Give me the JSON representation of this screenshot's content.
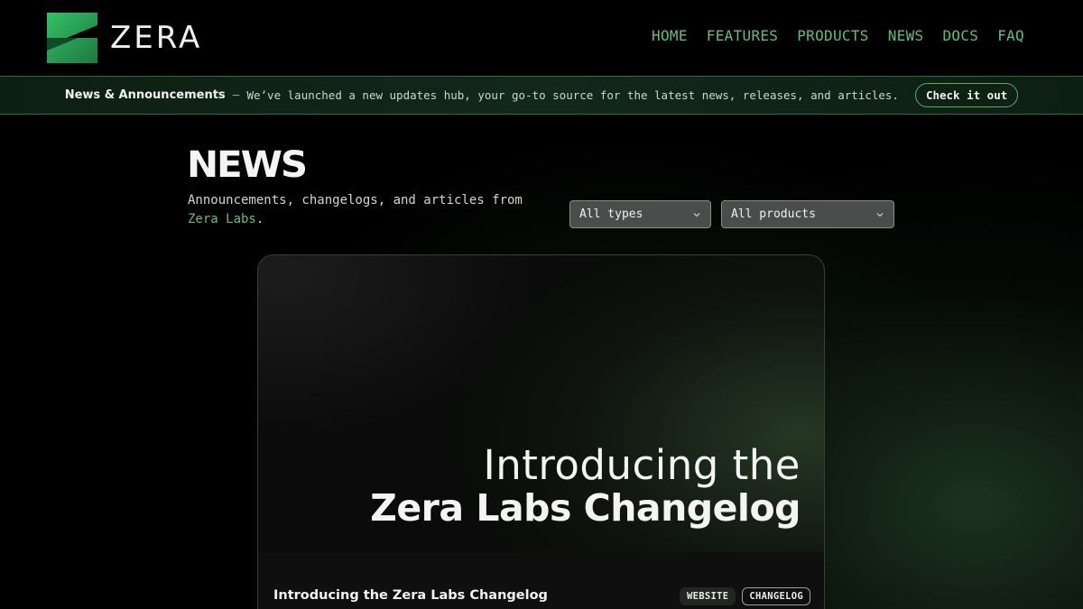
{
  "brand": {
    "name": "ZERA",
    "accent": "#5fbf7a",
    "logo_green": "#2aa84f"
  },
  "nav": {
    "items": [
      "HOME",
      "FEATURES",
      "PRODUCTS",
      "NEWS",
      "DOCS",
      "FAQ"
    ]
  },
  "announcement": {
    "title": "News & Announcements",
    "separator": "—",
    "text": "We’ve launched a new updates hub, your go-to source for the latest news, releases, and articles.",
    "button": "Check it out"
  },
  "page": {
    "title": "NEWS",
    "subtitle_prefix": "Announcements, changelogs, and articles from",
    "subtitle_link": "Zera Labs",
    "subtitle_suffix": "."
  },
  "filters": {
    "types": {
      "value": "All types",
      "icon": "chevron-down-icon"
    },
    "products": {
      "value": "All products",
      "icon": "chevron-down-icon"
    }
  },
  "featured": {
    "hero_line1": "Introducing the",
    "hero_line2": "Zera Labs Changelog",
    "title": "Introducing the Zera Labs Changelog",
    "tags": [
      "WEBSITE",
      "CHANGELOG"
    ]
  }
}
